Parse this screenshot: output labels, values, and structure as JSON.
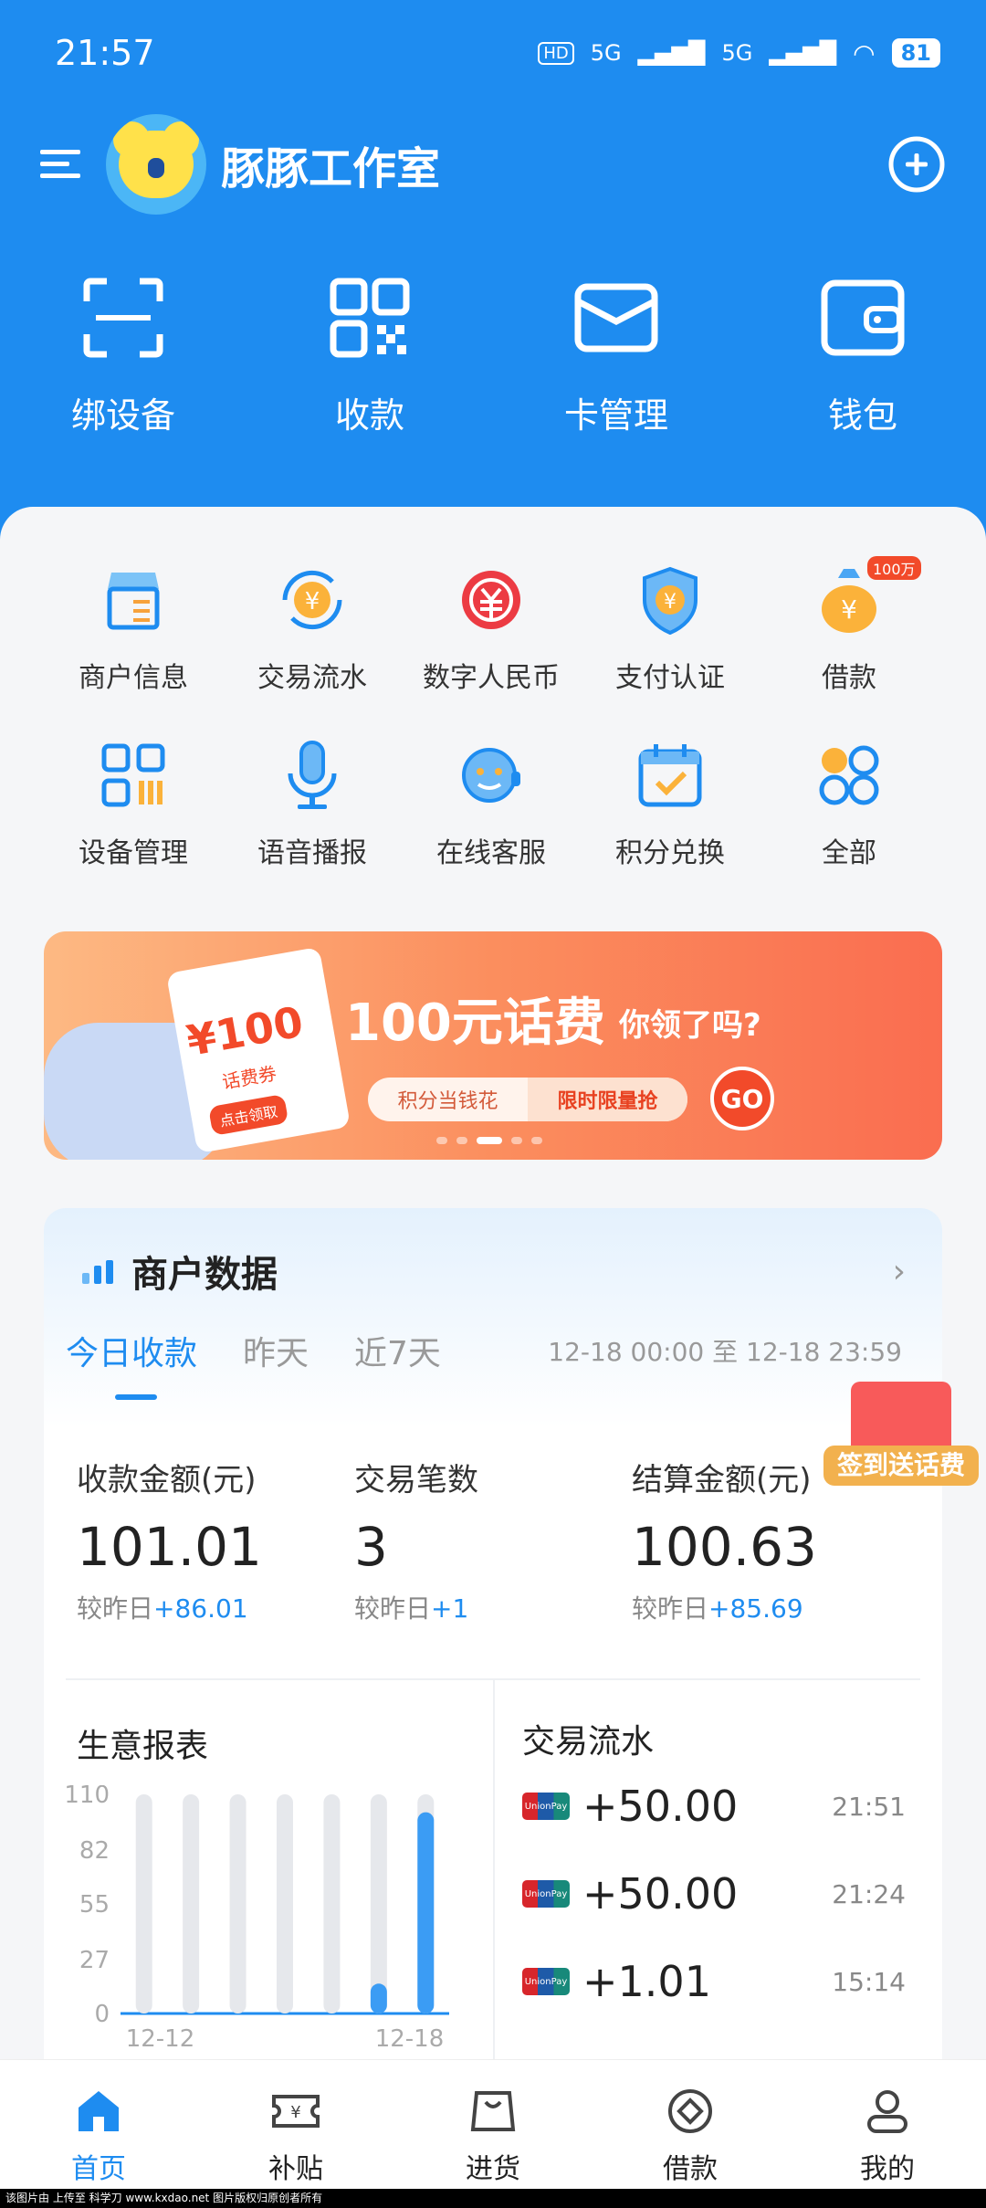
{
  "status": {
    "time": "21:57",
    "net1": "5G",
    "net2": "5G",
    "battery": "81"
  },
  "header": {
    "title": "豚豚工作室"
  },
  "quick": [
    {
      "label": "绑设备",
      "icon": "scan-icon"
    },
    {
      "label": "收款",
      "icon": "qrcode-icon"
    },
    {
      "label": "卡管理",
      "icon": "card-icon"
    },
    {
      "label": "钱包",
      "icon": "wallet-icon"
    }
  ],
  "grid": [
    {
      "label": "商户信息",
      "icon": "store-icon"
    },
    {
      "label": "交易流水",
      "icon": "yuan-cycle-icon"
    },
    {
      "label": "数字人民币",
      "icon": "digital-rmb-icon"
    },
    {
      "label": "支付认证",
      "icon": "shield-yuan-icon"
    },
    {
      "label": "借款",
      "icon": "moneybag-icon",
      "badge": "100万"
    },
    {
      "label": "设备管理",
      "icon": "device-grid-icon"
    },
    {
      "label": "语音播报",
      "icon": "microphone-icon"
    },
    {
      "label": "在线客服",
      "icon": "headset-icon"
    },
    {
      "label": "积分兑换",
      "icon": "calendar-check-icon"
    },
    {
      "label": "全部",
      "icon": "apps-icon"
    }
  ],
  "banner": {
    "title": "100元话费",
    "subtitle": "你领了吗?",
    "pill_left": "积分当钱花",
    "pill_right": "限时限量抢",
    "go": "GO",
    "ticket_amount": "¥100",
    "ticket_label": "话费券",
    "ticket_button": "点击领取",
    "active_slide": 3,
    "slides": 5
  },
  "merchant": {
    "title": "商户数据",
    "tabs": [
      "今日收款",
      "昨天",
      "近7天"
    ],
    "range": "12-18 00:00 至 12-18 23:59",
    "promo": "签到送话费",
    "stats": [
      {
        "label": "收款金额(元)",
        "value": "101.01",
        "compare_label": "较昨日",
        "compare_value": "+86.01"
      },
      {
        "label": "交易笔数",
        "value": "3",
        "compare_label": "较昨日",
        "compare_value": "+1"
      },
      {
        "label": "结算金额(元)",
        "value": "100.63",
        "compare_label": "较昨日",
        "compare_value": "+85.69"
      }
    ]
  },
  "report": {
    "title": "生意报表"
  },
  "chart_data": {
    "type": "bar",
    "categories": [
      "12-12",
      "12-13",
      "12-14",
      "12-15",
      "12-16",
      "12-17",
      "12-18"
    ],
    "values": [
      0,
      0,
      0,
      0,
      0,
      15,
      101.01
    ],
    "yticks": [
      110,
      82,
      55,
      27,
      0
    ],
    "ylim": [
      0,
      110
    ],
    "xlabels_shown": [
      "12-12",
      "12-18"
    ]
  },
  "flow": {
    "title": "交易流水",
    "rows": [
      {
        "amount": "+50.00",
        "time": "21:51"
      },
      {
        "amount": "+50.00",
        "time": "21:24"
      },
      {
        "amount": "+1.01",
        "time": "15:14"
      }
    ]
  },
  "nav": [
    {
      "label": "首页",
      "icon": "home-icon",
      "active": true
    },
    {
      "label": "补贴",
      "icon": "ticket-icon"
    },
    {
      "label": "进货",
      "icon": "bag-icon"
    },
    {
      "label": "借款",
      "icon": "loan-icon"
    },
    {
      "label": "我的",
      "icon": "user-icon"
    }
  ],
  "footer": "该图片由 上传至 科学刀 www.kxdao.net 图片版权归原创者所有",
  "colors": {
    "primary": "#1e8cf0",
    "accent_red": "#f24a2a"
  }
}
